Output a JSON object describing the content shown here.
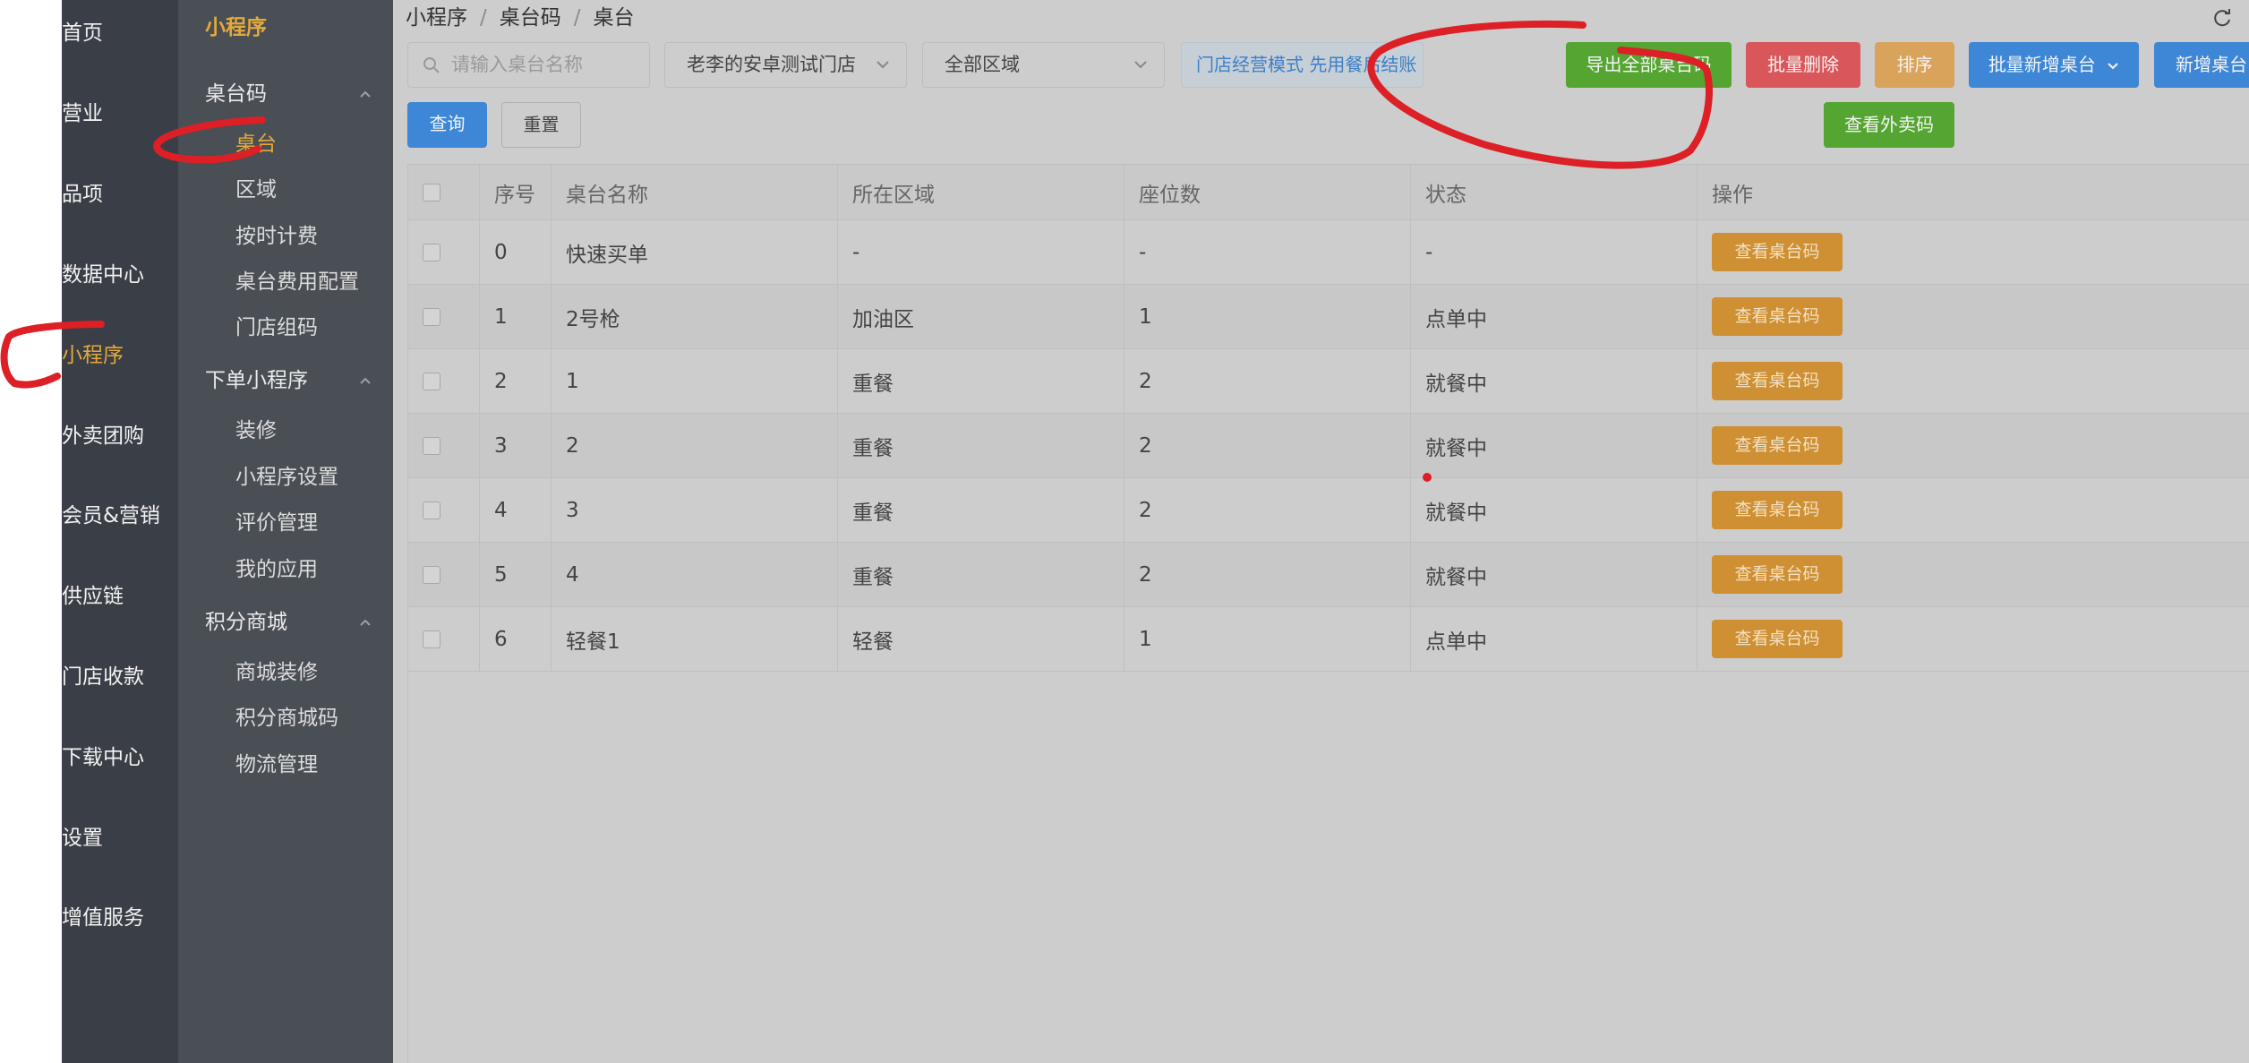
{
  "nav": {
    "items": [
      "首页",
      "营业",
      "品项",
      "数据中心",
      "小程序",
      "外卖团购",
      "会员&营销",
      "供应链",
      "门店收款",
      "下载中心",
      "设置",
      "增值服务"
    ],
    "active_index": 4
  },
  "subnav": {
    "title": "小程序",
    "groups": [
      {
        "label": "桌台码",
        "items": [
          "桌台",
          "区域",
          "按时计费",
          "桌台费用配置",
          "门店组码"
        ]
      },
      {
        "label": "下单小程序",
        "items": [
          "装修",
          "小程序设置",
          "评价管理",
          "我的应用"
        ]
      },
      {
        "label": "积分商城",
        "items": [
          "商城装修",
          "积分商城码",
          "物流管理"
        ]
      }
    ],
    "active": "桌台"
  },
  "breadcrumb": [
    "小程序",
    "桌台码",
    "桌台"
  ],
  "filters": {
    "search_placeholder": "请输入桌台名称",
    "store_select": "老李的安卓测试门店",
    "area_select": "全部区域",
    "mode_notice": "门店经营模式 先用餐后结账"
  },
  "buttons": {
    "export_all": "导出全部桌台码",
    "batch_delete": "批量删除",
    "sort": "排序",
    "batch_add": "批量新增桌台",
    "add": "新增桌台",
    "view_takeout": "查看外卖码",
    "query": "查询",
    "reset": "重置"
  },
  "table": {
    "columns": [
      "序号",
      "桌台名称",
      "所在区域",
      "座位数",
      "状态",
      "操作"
    ],
    "rows": [
      [
        "0",
        "快速买单",
        "-",
        "-",
        "-"
      ],
      [
        "1",
        "2号枪",
        "加油区",
        "1",
        "点单中"
      ],
      [
        "2",
        "1",
        "重餐",
        "2",
        "就餐中"
      ],
      [
        "3",
        "2",
        "重餐",
        "2",
        "就餐中"
      ],
      [
        "4",
        "3",
        "重餐",
        "2",
        "就餐中"
      ],
      [
        "5",
        "4",
        "重餐",
        "2",
        "就餐中"
      ],
      [
        "6",
        "轻餐1",
        "轻餐",
        "1",
        "点单中"
      ]
    ],
    "action_label": "查看桌台码"
  },
  "colors": {
    "accent": "#e4a93a",
    "green": "#55a532",
    "red": "#d9575a",
    "orange": "#d9a35b",
    "blue": "#3d87d6",
    "annotation": "#dd1f26"
  },
  "icons": [
    "search-icon",
    "chevron-up-icon",
    "chevron-down-icon",
    "refresh-icon"
  ]
}
